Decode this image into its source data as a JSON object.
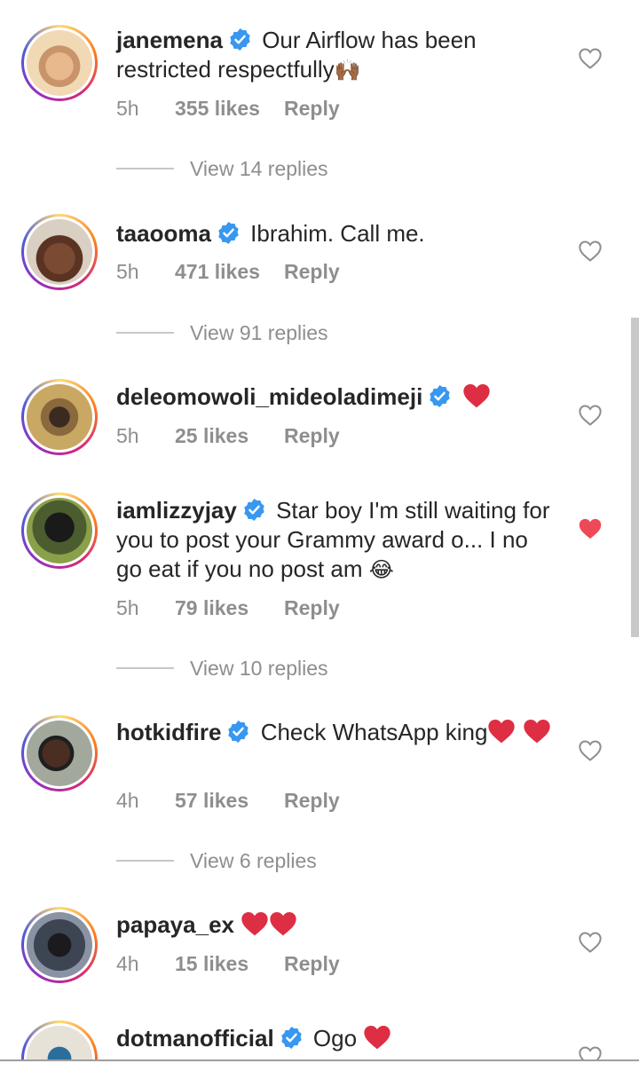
{
  "comments": [
    {
      "username": "janemena",
      "verified": true,
      "text": "Our Airflow has been restricted respectfully",
      "emoji": "🙌🏾",
      "time": "5h",
      "likes": "355 likes",
      "reply": "Reply",
      "liked": false,
      "view_replies": "View 14 replies"
    },
    {
      "username": "taaooma",
      "verified": true,
      "text": "Ibrahim. Call me.",
      "time": "5h",
      "likes": "471 likes",
      "reply": "Reply",
      "liked": false,
      "view_replies": "View 91 replies"
    },
    {
      "username": "deleomowoli_mideoladimeji",
      "verified": true,
      "text": "",
      "time": "5h",
      "likes": "25 likes",
      "reply": "Reply",
      "liked": false
    },
    {
      "username": "iamlizzyjay",
      "verified": true,
      "text": "Star boy I'm still waiting for you to post your Grammy award o... I no go eat if you no post am",
      "emoji": "😂",
      "time": "5h",
      "likes": "79 likes",
      "reply": "Reply",
      "liked": true,
      "view_replies": "View 10 replies"
    },
    {
      "username": "hotkidfire",
      "verified": true,
      "text": "Check WhatsApp king",
      "time": "4h",
      "likes": "57 likes",
      "reply": "Reply",
      "liked": false,
      "view_replies": "View 6 replies"
    },
    {
      "username": "papaya_ex",
      "verified": false,
      "text": "",
      "time": "4h",
      "likes": "15 likes",
      "reply": "Reply",
      "liked": false
    },
    {
      "username": "dotmanofficial",
      "verified": true,
      "text": "Ogo",
      "liked": false
    }
  ],
  "colors": {
    "liked_heart": "#ed4956",
    "verified_blue": "#3897f0",
    "muted": "#8e8e8e"
  },
  "icons": {
    "verified": "verified-badge-icon",
    "like": "heart-outline-icon",
    "liked": "heart-filled-icon"
  }
}
